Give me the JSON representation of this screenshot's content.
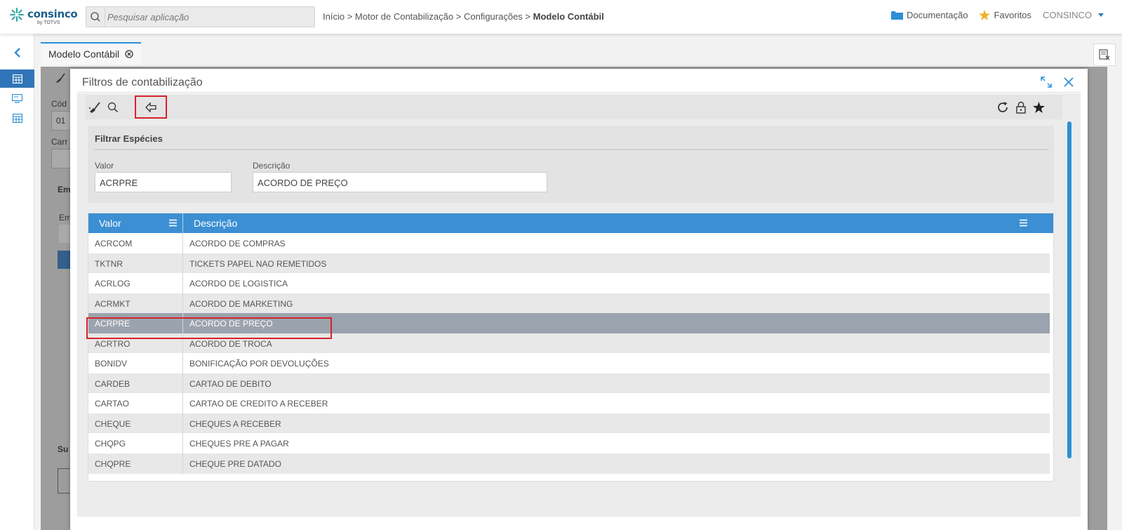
{
  "app": {
    "logo_text": "consinco",
    "logo_sub": "by TOTVS"
  },
  "search": {
    "placeholder": "Pesquisar aplicação"
  },
  "breadcrumb": {
    "items": [
      "Início",
      "Motor de Contabilização",
      "Configurações"
    ],
    "separator": ">",
    "current": "Modelo Contábil"
  },
  "top_links": {
    "documentation": "Documentação",
    "favorites": "Favoritos",
    "user": "CONSINCO"
  },
  "tabs": [
    {
      "label": "Modelo Contábil"
    }
  ],
  "background": {
    "label_cod": "Cód",
    "value_cod": "01",
    "label_car": "Carr",
    "label_em": "Em",
    "label_em2": "Em",
    "label_su": "Su"
  },
  "modal": {
    "title": "Filtros de contabilização",
    "filter_section_title": "Filtrar Espécies",
    "fields": {
      "valor_label": "Valor",
      "valor_value": "ACRPRE",
      "descricao_label": "Descrição",
      "descricao_value": "ACORDO DE PREÇO"
    },
    "grid": {
      "columns": [
        "Valor",
        "Descrição"
      ],
      "selected_index": 4,
      "rows": [
        {
          "valor": "ACRCOM",
          "descricao": "ACORDO DE COMPRAS"
        },
        {
          "valor": "TKTNR",
          "descricao": "TICKETS PAPEL NAO REMETIDOS"
        },
        {
          "valor": "ACRLOG",
          "descricao": "ACORDO DE LOGISTICA"
        },
        {
          "valor": "ACRMKT",
          "descricao": "ACORDO DE MARKETING"
        },
        {
          "valor": "ACRPRE",
          "descricao": "ACORDO DE PREÇO"
        },
        {
          "valor": "ACRTRO",
          "descricao": "ACORDO DE TROCA"
        },
        {
          "valor": "BONIDV",
          "descricao": "BONIFICAÇÃO POR DEVOLUÇÕES"
        },
        {
          "valor": "CARDEB",
          "descricao": "CARTAO DE DEBITO"
        },
        {
          "valor": "CARTAO",
          "descricao": "CARTAO DE CREDITO A RECEBER"
        },
        {
          "valor": "CHEQUE",
          "descricao": "CHEQUES A RECEBER"
        },
        {
          "valor": "CHQPG",
          "descricao": "CHEQUES PRE A PAGAR"
        },
        {
          "valor": "CHQPRE",
          "descricao": "CHEQUE PRE DATADO"
        }
      ]
    }
  },
  "colors": {
    "accent": "#2d8fd4",
    "header": "#3b8fd2",
    "highlight": "#d9232b",
    "selected_row": "#9aa3ae"
  }
}
